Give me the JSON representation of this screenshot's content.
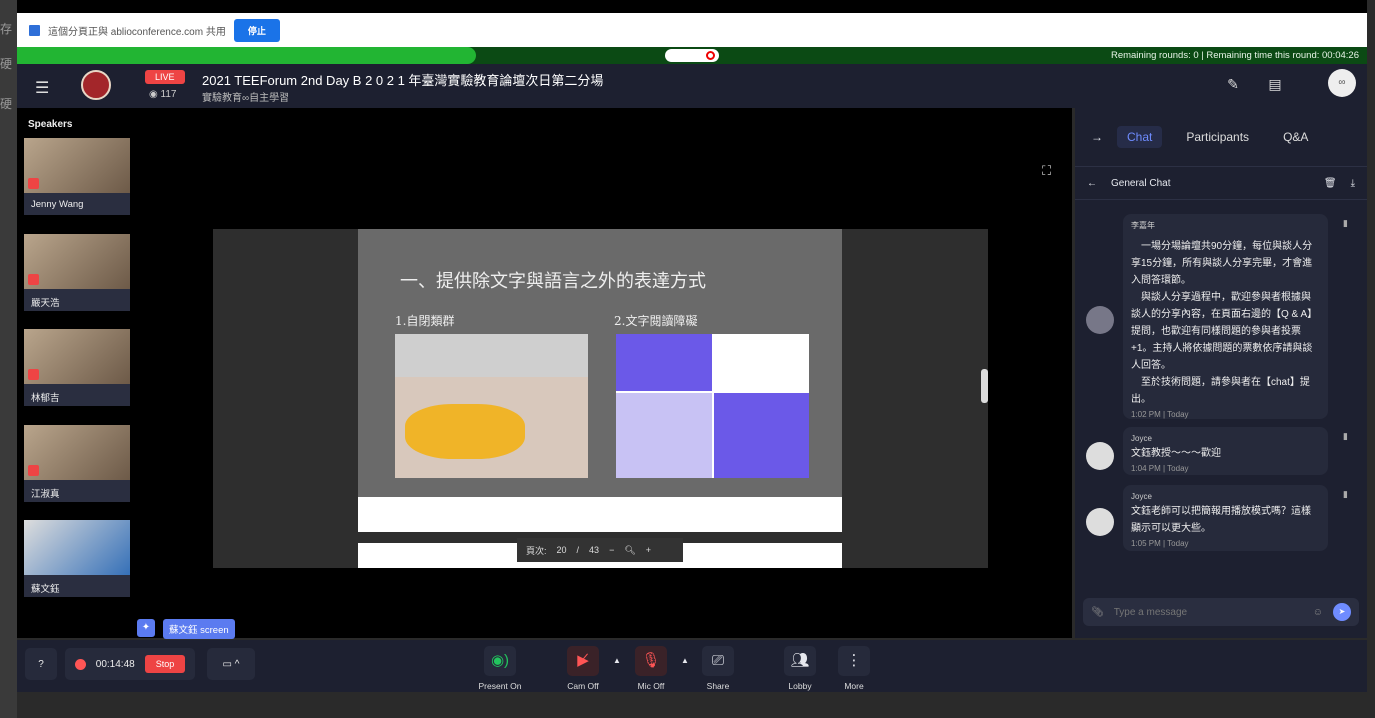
{
  "sharebar": {
    "text": "這個分頁正與 ablioconference.com 共用",
    "stop_label": "停止"
  },
  "timer": {
    "text": "Remaining rounds: 0 | Remaining time this round: 00:04:26",
    "progress_percent": 34
  },
  "header": {
    "live": "LIVE",
    "viewers": "117",
    "title": "2021 TEEForum 2nd Day B 2 0 2 1 年臺灣實驗教育論壇次日第二分場",
    "subtitle": "實驗教育∞自主學習"
  },
  "speakers": {
    "label": "Speakers",
    "items": [
      {
        "name": "Jenny Wang"
      },
      {
        "name": "嚴天浩"
      },
      {
        "name": "林郁吉"
      },
      {
        "name": "江淑真"
      },
      {
        "name": "蘇文鈺"
      }
    ]
  },
  "slide": {
    "title": "一、提供除文字與語言之外的表達方式",
    "caption1": "1.自閉類群",
    "caption2": "2.文字閱讀障礙",
    "page_label": "頁次:",
    "page": "20",
    "sep": "/",
    "total": "43"
  },
  "screen_label": "蘇文鈺 screen",
  "chat": {
    "tabs": [
      "Chat",
      "Participants",
      "Q&A"
    ],
    "active_tab": "Chat",
    "channel": "General Chat",
    "messages": [
      {
        "sender": "李嘉年",
        "text": "　一場分場論壇共90分鐘，每位與談人分享15分鐘，所有與談人分享完畢，才會進入問答環節。\n　與談人分享過程中，歡迎參與者根據與談人的分享內容，在頁面右邊的【Q & A】提問，也歡迎有同樣問題的參與者投票+1。主持人將依據問題的票數依序請與談人回答。\n　至於技術問題，請參與者在【chat】提出。",
        "time": "1:02 PM | Today"
      },
      {
        "sender": "Joyce",
        "text": "文鈺教授～～～歡迎",
        "time": "1:04 PM | Today"
      },
      {
        "sender": "Joyce",
        "text": "文鈺老師可以把簡報用播放模式嗎？這樣顯示可以更大些。",
        "time": "1:05 PM | Today"
      }
    ],
    "input_placeholder": "Type a message"
  },
  "bottombar": {
    "rec_time": "00:14:48",
    "rec_stop": "Stop",
    "controls": [
      "Present On",
      "Cam Off",
      "Mic Off",
      "Share",
      "Lobby",
      "More"
    ]
  },
  "colors": {
    "accent": "#6f8cff",
    "live": "#e44444",
    "present": "#22c55e",
    "timer_bg": "#0b4a14",
    "timer_fill": "#22b533"
  }
}
